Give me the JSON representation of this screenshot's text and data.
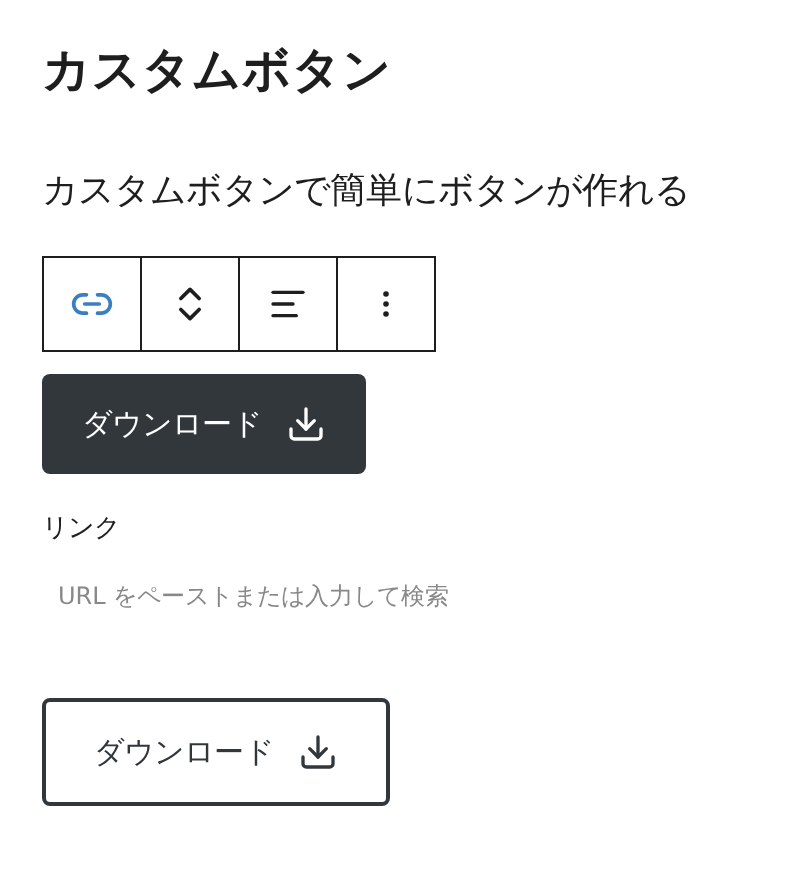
{
  "title": "カスタムボタン",
  "description": "カスタムボタンで簡単にボタンが作れる",
  "toolbar": [
    {
      "kind": "link",
      "selected": true
    },
    {
      "kind": "move",
      "selected": false
    },
    {
      "kind": "align",
      "selected": false
    },
    {
      "kind": "more",
      "selected": false
    }
  ],
  "preview_button": {
    "label": "ダウンロード",
    "kind": "filled"
  },
  "link": {
    "label": "リンク",
    "placeholder": "URL をペーストまたは入力して検索"
  },
  "result_button": {
    "label": "ダウンロード",
    "kind": "outline"
  }
}
